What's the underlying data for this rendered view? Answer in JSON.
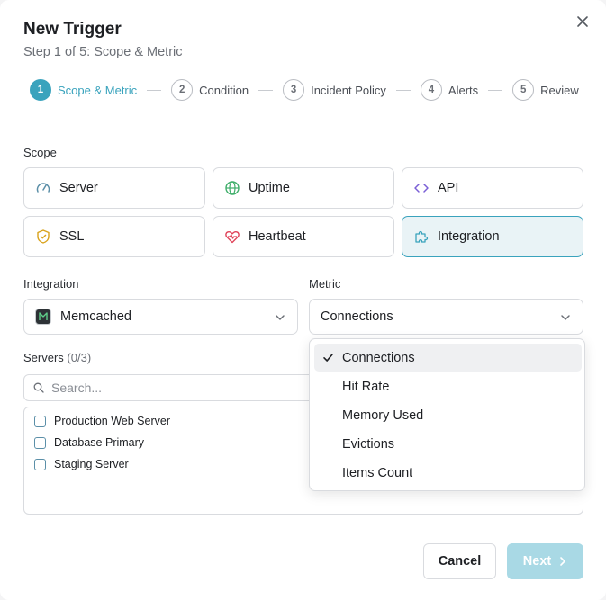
{
  "header": {
    "title": "New Trigger",
    "subtitle": "Step 1 of 5: Scope & Metric"
  },
  "stepper": {
    "steps": [
      {
        "num": "1",
        "label": "Scope & Metric",
        "active": true
      },
      {
        "num": "2",
        "label": "Condition",
        "active": false
      },
      {
        "num": "3",
        "label": "Incident Policy",
        "active": false
      },
      {
        "num": "4",
        "label": "Alerts",
        "active": false
      },
      {
        "num": "5",
        "label": "Review",
        "active": false
      }
    ]
  },
  "scope": {
    "label": "Scope",
    "options": [
      {
        "label": "Server",
        "icon": "gauge-icon"
      },
      {
        "label": "Uptime",
        "icon": "globe-icon"
      },
      {
        "label": "API",
        "icon": "code-icon"
      },
      {
        "label": "SSL",
        "icon": "shield-check-icon"
      },
      {
        "label": "Heartbeat",
        "icon": "heart-pulse-icon"
      },
      {
        "label": "Integration",
        "icon": "puzzle-icon",
        "selected": true
      }
    ]
  },
  "integration": {
    "label": "Integration",
    "value": "Memcached"
  },
  "metric": {
    "label": "Metric",
    "value": "Connections",
    "options": [
      "Connections",
      "Hit Rate",
      "Memory Used",
      "Evictions",
      "Items Count"
    ],
    "selected_index": 0
  },
  "servers": {
    "label": "Servers",
    "count": "(0/3)",
    "search_placeholder": "Search...",
    "items": [
      "Production Web Server",
      "Database Primary",
      "Staging Server"
    ]
  },
  "footer": {
    "cancel_label": "Cancel",
    "next_label": "Next"
  },
  "colors": {
    "accent": "#3aa3bd",
    "selected_bg": "#e9f3f6",
    "next_disabled": "#a9d9e5"
  }
}
